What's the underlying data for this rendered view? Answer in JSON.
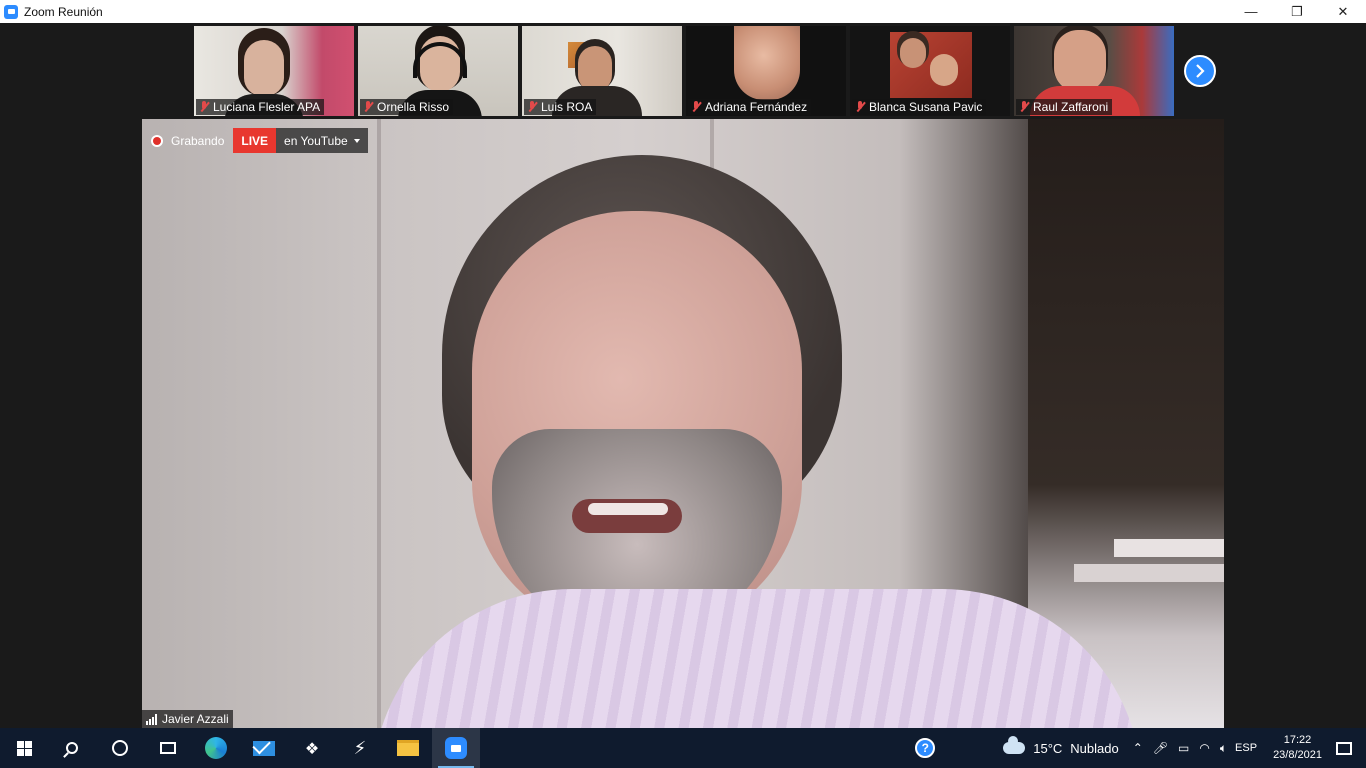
{
  "window": {
    "title": "Zoom Reunión",
    "controls": {
      "minimize": "—",
      "restore": "❐",
      "close": "✕"
    }
  },
  "participants": [
    {
      "name": "Luciana Flesler APA",
      "muted": true
    },
    {
      "name": "Ornella Risso",
      "muted": true
    },
    {
      "name": "Luis ROA",
      "muted": true
    },
    {
      "name": "Adriana Fernández",
      "muted": true
    },
    {
      "name": "Blanca Susana Pavic",
      "muted": true
    },
    {
      "name": "Raul Zaffaroni",
      "muted": true
    }
  ],
  "next_page_icon": "chevron-right-icon",
  "recording": {
    "label": "Grabando",
    "live_badge": "LIVE",
    "live_target": "en YouTube"
  },
  "active_speaker": {
    "name": "Javier Azzali"
  },
  "taskbar": {
    "apps": [
      "start",
      "search",
      "cortana",
      "task-view",
      "edge",
      "mail",
      "dropbox",
      "bolt",
      "file-explorer",
      "zoom"
    ],
    "weather": {
      "temperature": "15°C",
      "condition": "Nublado"
    },
    "language": "ESP",
    "time": "17:22",
    "date": "23/8/2021"
  },
  "colors": {
    "accent": "#2d8cff",
    "live": "#e8372f",
    "muted": "#e24a4a",
    "taskbar": "#0f1b2e"
  }
}
